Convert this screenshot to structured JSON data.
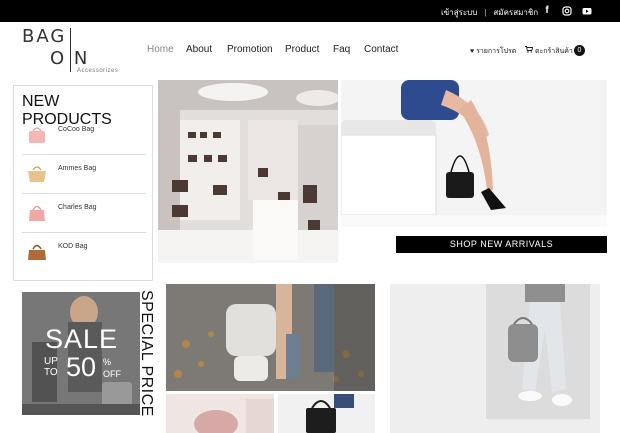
{
  "topbar": {
    "login": "เข้าสู่ระบบ",
    "separator": "|",
    "register": "สมัครสมาชิก",
    "social": [
      "facebook-icon",
      "instagram-icon",
      "youtube-icon"
    ]
  },
  "logo": {
    "line1": "BAG",
    "line2": "O N",
    "tagline": "Accessorizes"
  },
  "nav": {
    "items": [
      "Home",
      "About",
      "Promotion",
      "Product",
      "Faq",
      "Contact"
    ],
    "active": "Home"
  },
  "header_right": {
    "wishlist": "รายการโปรด",
    "cart": "ตะกร้าสินค้า",
    "cart_count": "0"
  },
  "new_products": {
    "title": "NEW PRODUCTS",
    "items": [
      {
        "name": "CoCoo Bag",
        "color": "#f2b9b4"
      },
      {
        "name": "Ammes Bag",
        "color": "#e8c38e"
      },
      {
        "name": "Charles Bag",
        "color": "#f3a8a6"
      },
      {
        "name": "KOD Bag",
        "color": "#b06a3a"
      }
    ]
  },
  "banner": {
    "button": "SHOP NEW ARRIVALS"
  },
  "sale": {
    "title": "SALE",
    "up_to": "UP\nTO",
    "percent": "50",
    "pct_sign": "%",
    "off": "OFF",
    "vertical": "SPECIAL PRICE"
  }
}
